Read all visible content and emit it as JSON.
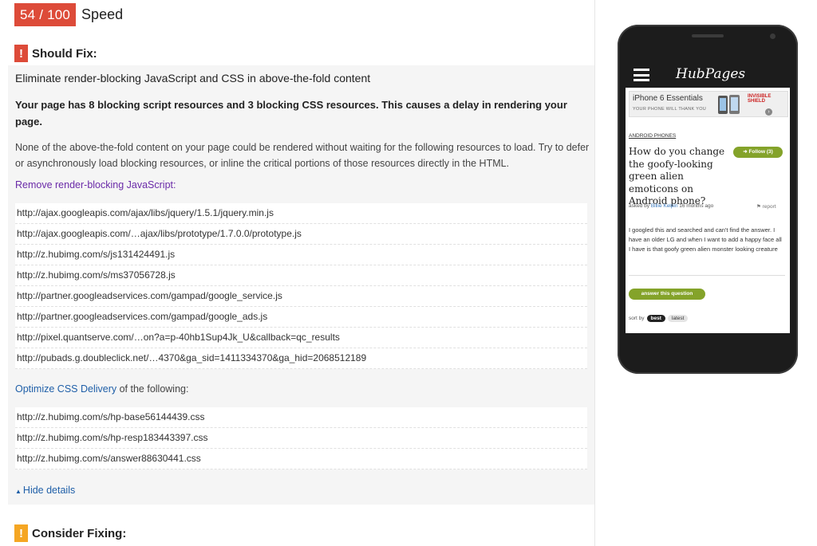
{
  "score": {
    "value": "54 / 100",
    "label": "Speed"
  },
  "should_fix": {
    "icon": "!",
    "title": "Should Fix:",
    "rule_title": "Eliminate render-blocking JavaScript and CSS in above-the-fold content",
    "summary": "Your page has 8 blocking script resources and 3 blocking CSS resources. This causes a delay in rendering your page.",
    "description": "None of the above-the-fold content on your page could be rendered without waiting for the following resources to load. Try to defer or asynchronously load blocking resources, or inline the critical portions of those resources directly in the HTML.",
    "js_link": "Remove render-blocking JavaScript",
    "js_link_suffix": ":",
    "js_resources": [
      "http://ajax.googleapis.com/ajax/libs/jquery/1.5.1/jquery.min.js",
      "http://ajax.googleapis.com/…ajax/libs/prototype/1.7.0.0/prototype.js",
      "http://z.hubimg.com/s/js131424491.js",
      "http://z.hubimg.com/s/ms37056728.js",
      "http://partner.googleadservices.com/gampad/google_service.js",
      "http://partner.googleadservices.com/gampad/google_ads.js",
      "http://pixel.quantserve.com/…on?a=p-40hb1Sup4Jk_U&callback=qc_results",
      "http://pubads.g.doubleclick.net/…4370&ga_sid=1411334370&ga_hid=2068512189"
    ],
    "css_link": "Optimize CSS Delivery",
    "css_link_suffix": " of the following:",
    "css_resources": [
      "http://z.hubimg.com/s/hp-base56144439.css",
      "http://z.hubimg.com/s/hp-resp183443397.css",
      "http://z.hubimg.com/s/answer88630441.css"
    ],
    "hide_details": "Hide details"
  },
  "consider_fixing": {
    "icon": "!",
    "title": "Consider Fixing:"
  },
  "preview": {
    "logo": "HubPages",
    "ad_title": "iPhone 6 Essentials",
    "ad_sub": "YOUR PHONE WILL THANK YOU",
    "ad_brand_top": "INVISIBLE",
    "ad_brand_bottom": "SHIELD",
    "category": "ANDROID PHONES",
    "question": "How do you change the goofy-looking green alien emoticons on Android phone?",
    "follow": "Follow (3)",
    "meta_prefix": "asked by ",
    "author": "Billie Kelpin",
    "meta_suffix": " 16 months ago",
    "report": "report",
    "body": "I googled this and searched and can't find the answer. I have an older LG and when I want to add a happy face all I have is that goofy green alien monster looking creature",
    "answer_button": "answer this question",
    "sort_label": "sort by",
    "sort_best": "best",
    "sort_latest": "latest"
  },
  "colors": {
    "danger": "#dd4b39",
    "warning": "#f5a623",
    "link": "#1f5fa8",
    "visited_link": "#6a2aa8",
    "hub_green": "#84a32a"
  }
}
